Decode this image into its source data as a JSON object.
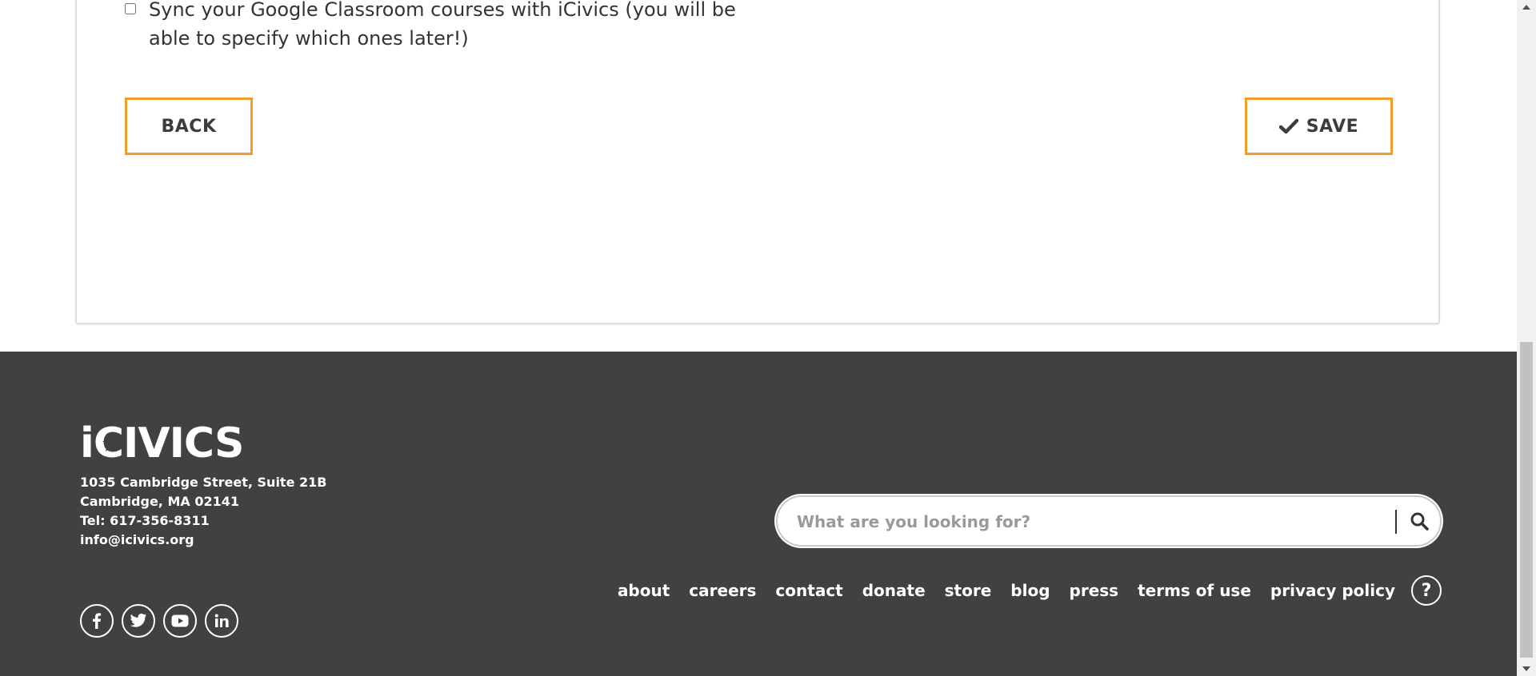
{
  "form": {
    "sync_label": "Sync your Google Classroom courses with iCivics (you will be able to specify which ones later!)",
    "sync_checked": false,
    "back_label": "BACK",
    "save_label": "SAVE",
    "accent_color": "#f39c2b"
  },
  "footer": {
    "brand": "iCivics",
    "address_line1": "1035 Cambridge Street, Suite 21B",
    "address_line2": "Cambridge, MA 02141",
    "phone": "Tel: 617-356-8311",
    "email": "info@icivics.org",
    "background_color": "#414143",
    "socials": [
      "facebook-icon",
      "twitter-icon",
      "youtube-icon",
      "linkedin-icon"
    ],
    "search": {
      "placeholder": "What are you looking for?"
    },
    "links": [
      "about",
      "careers",
      "contact",
      "donate",
      "store",
      "blog",
      "press",
      "terms of use",
      "privacy policy"
    ],
    "help_label": "?"
  }
}
